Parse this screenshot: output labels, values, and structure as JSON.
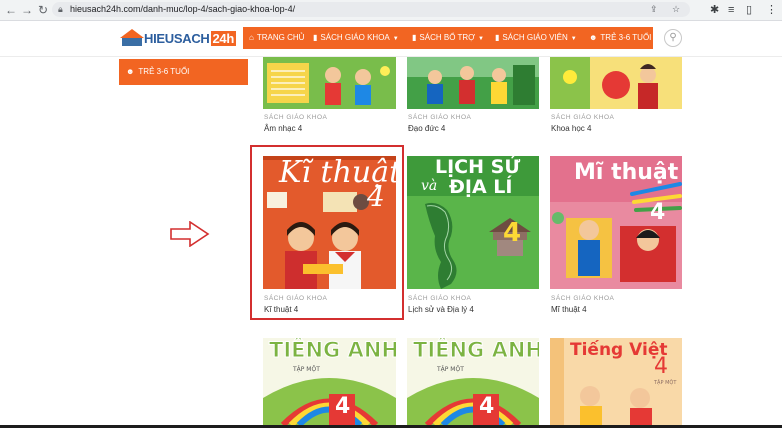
{
  "browser": {
    "url": "hieusach24h.com/danh-muc/lop-4/sach-giao-khoa-lop-4/",
    "icons": [
      "back-icon",
      "forward-icon",
      "reload-icon",
      "lock-icon",
      "share-icon",
      "star-icon",
      "extensions-icon",
      "reading-list-icon",
      "sidebar-icon",
      "menu-icon"
    ]
  },
  "site": {
    "logo_text": "HIEUSACH",
    "logo_badge": "24h",
    "menu": [
      {
        "label": "TRANG CHỦ",
        "icon": "home-icon"
      },
      {
        "label": "SÁCH GIÁO KHOA",
        "icon": "book-icon"
      },
      {
        "label": "SÁCH BỔ TRỢ",
        "icon": "book-icon"
      },
      {
        "label": "SÁCH GIÁO VIÊN",
        "icon": "book-icon"
      },
      {
        "label": "TRẺ 3-6 TUỔI",
        "icon": "child-icon"
      }
    ],
    "sidebar_item": "TRẺ 3-6 TUỔI"
  },
  "products": [
    {
      "category": "SÁCH GIÁO KHOA",
      "name": "Âm nhạc 4"
    },
    {
      "category": "SÁCH GIÁO KHOA",
      "name": "Đạo đức 4"
    },
    {
      "category": "SÁCH GIÁO KHOA",
      "name": "Khoa học 4"
    },
    {
      "category": "SÁCH GIÁO KHOA",
      "name": "Kĩ thuật 4"
    },
    {
      "category": "SÁCH GIÁO KHOA",
      "name": "Lịch sử và Địa lý 4"
    },
    {
      "category": "SÁCH GIÁO KHOA",
      "name": "Mĩ thuật 4"
    },
    {
      "category": "",
      "name": ""
    },
    {
      "category": "",
      "name": ""
    },
    {
      "category": "",
      "name": ""
    }
  ],
  "covers": {
    "kithuat": {
      "title": "Kĩ thuật",
      "num": "4"
    },
    "lichsu": {
      "line1": "LỊCH SỬ",
      "line2": "và",
      "line3": "ĐỊA LÍ",
      "num": "4"
    },
    "mithuat": {
      "title": "Mĩ thuật",
      "num": "4"
    },
    "tienganh": {
      "title": "TIẾNG ANH",
      "sub": "TẬP MỘT",
      "num": "4"
    },
    "tiengviet": {
      "title": "Tiếng Việt",
      "num": "4",
      "sub": "TẬP MỘT"
    }
  },
  "colors": {
    "brand_orange": "#f26522",
    "highlight_red": "#d32f2f",
    "logo_blue": "#2c5e9e"
  }
}
